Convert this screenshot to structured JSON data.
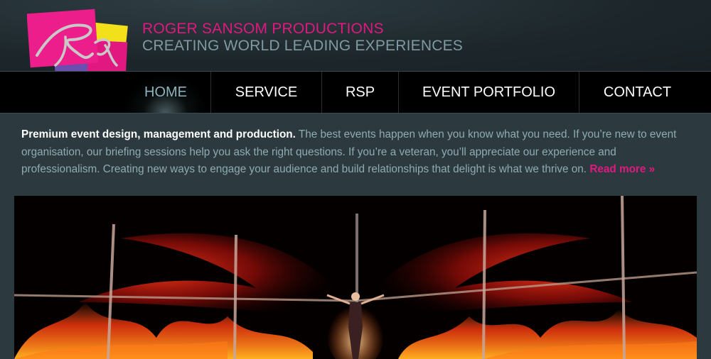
{
  "header": {
    "logo_alt": "RSP",
    "title": "ROGER SANSOM PRODUCTIONS",
    "tagline": "CREATING WORLD LEADING EXPERIENCES"
  },
  "nav": {
    "items": [
      {
        "label": "HOME",
        "active": true
      },
      {
        "label": "SERVICE"
      },
      {
        "label": "RSP"
      },
      {
        "label": "EVENT PORTFOLIO"
      },
      {
        "label": "CONTACT"
      }
    ]
  },
  "intro": {
    "lead": "Premium event design, management and production.",
    "body": " The best events happen when you know what you need. If you’re new to event organisation, our briefing sessions help you ask the right questions. If you’re a veteran, you’ll appreciate our experience and professionalism. Creating new ways to engage your audience and build relationships that delight is what we thrive on. ",
    "read_more": "Read more »"
  },
  "hero": {
    "description": "performer with fiery wings on stage"
  },
  "colors": {
    "accent": "#e0187f",
    "tagline": "#7f9aa1",
    "body_text": "#8fabb2",
    "background": "#2c3a3f"
  }
}
